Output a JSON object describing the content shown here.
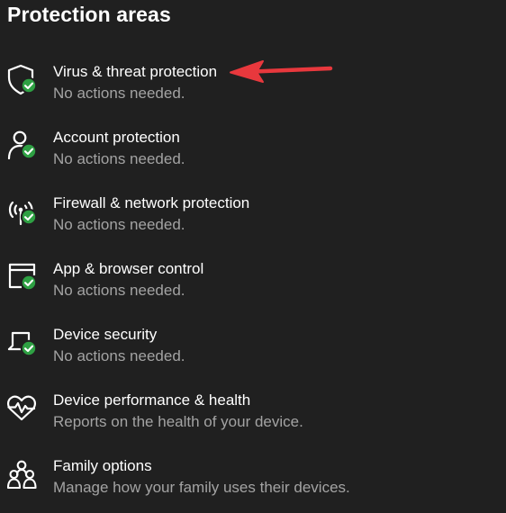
{
  "page": {
    "heading": "Protection areas"
  },
  "areas": [
    {
      "title": "Virus & threat protection",
      "subtitle": "No actions needed.",
      "icon": "shield-icon",
      "status_icon": "green-check-badge"
    },
    {
      "title": "Account protection",
      "subtitle": "No actions needed.",
      "icon": "person-icon",
      "status_icon": "green-check-badge"
    },
    {
      "title": "Firewall & network protection",
      "subtitle": "No actions needed.",
      "icon": "wireless-signal-icon",
      "status_icon": "green-check-badge"
    },
    {
      "title": "App & browser control",
      "subtitle": "No actions needed.",
      "icon": "browser-window-icon",
      "status_icon": "green-check-badge"
    },
    {
      "title": "Device security",
      "subtitle": "No actions needed.",
      "icon": "laptop-icon",
      "status_icon": "green-check-badge"
    },
    {
      "title": "Device performance & health",
      "subtitle": "Reports on the health of your device.",
      "icon": "heart-pulse-icon"
    },
    {
      "title": "Family options",
      "subtitle": "Manage how your family uses their devices.",
      "icon": "family-icon"
    }
  ],
  "colors": {
    "background": "#202020",
    "title_text": "#ffffff",
    "subtitle_text": "#a3a3a3",
    "status_ok": "#2ea043",
    "annotation_arrow": "#e8383d"
  }
}
